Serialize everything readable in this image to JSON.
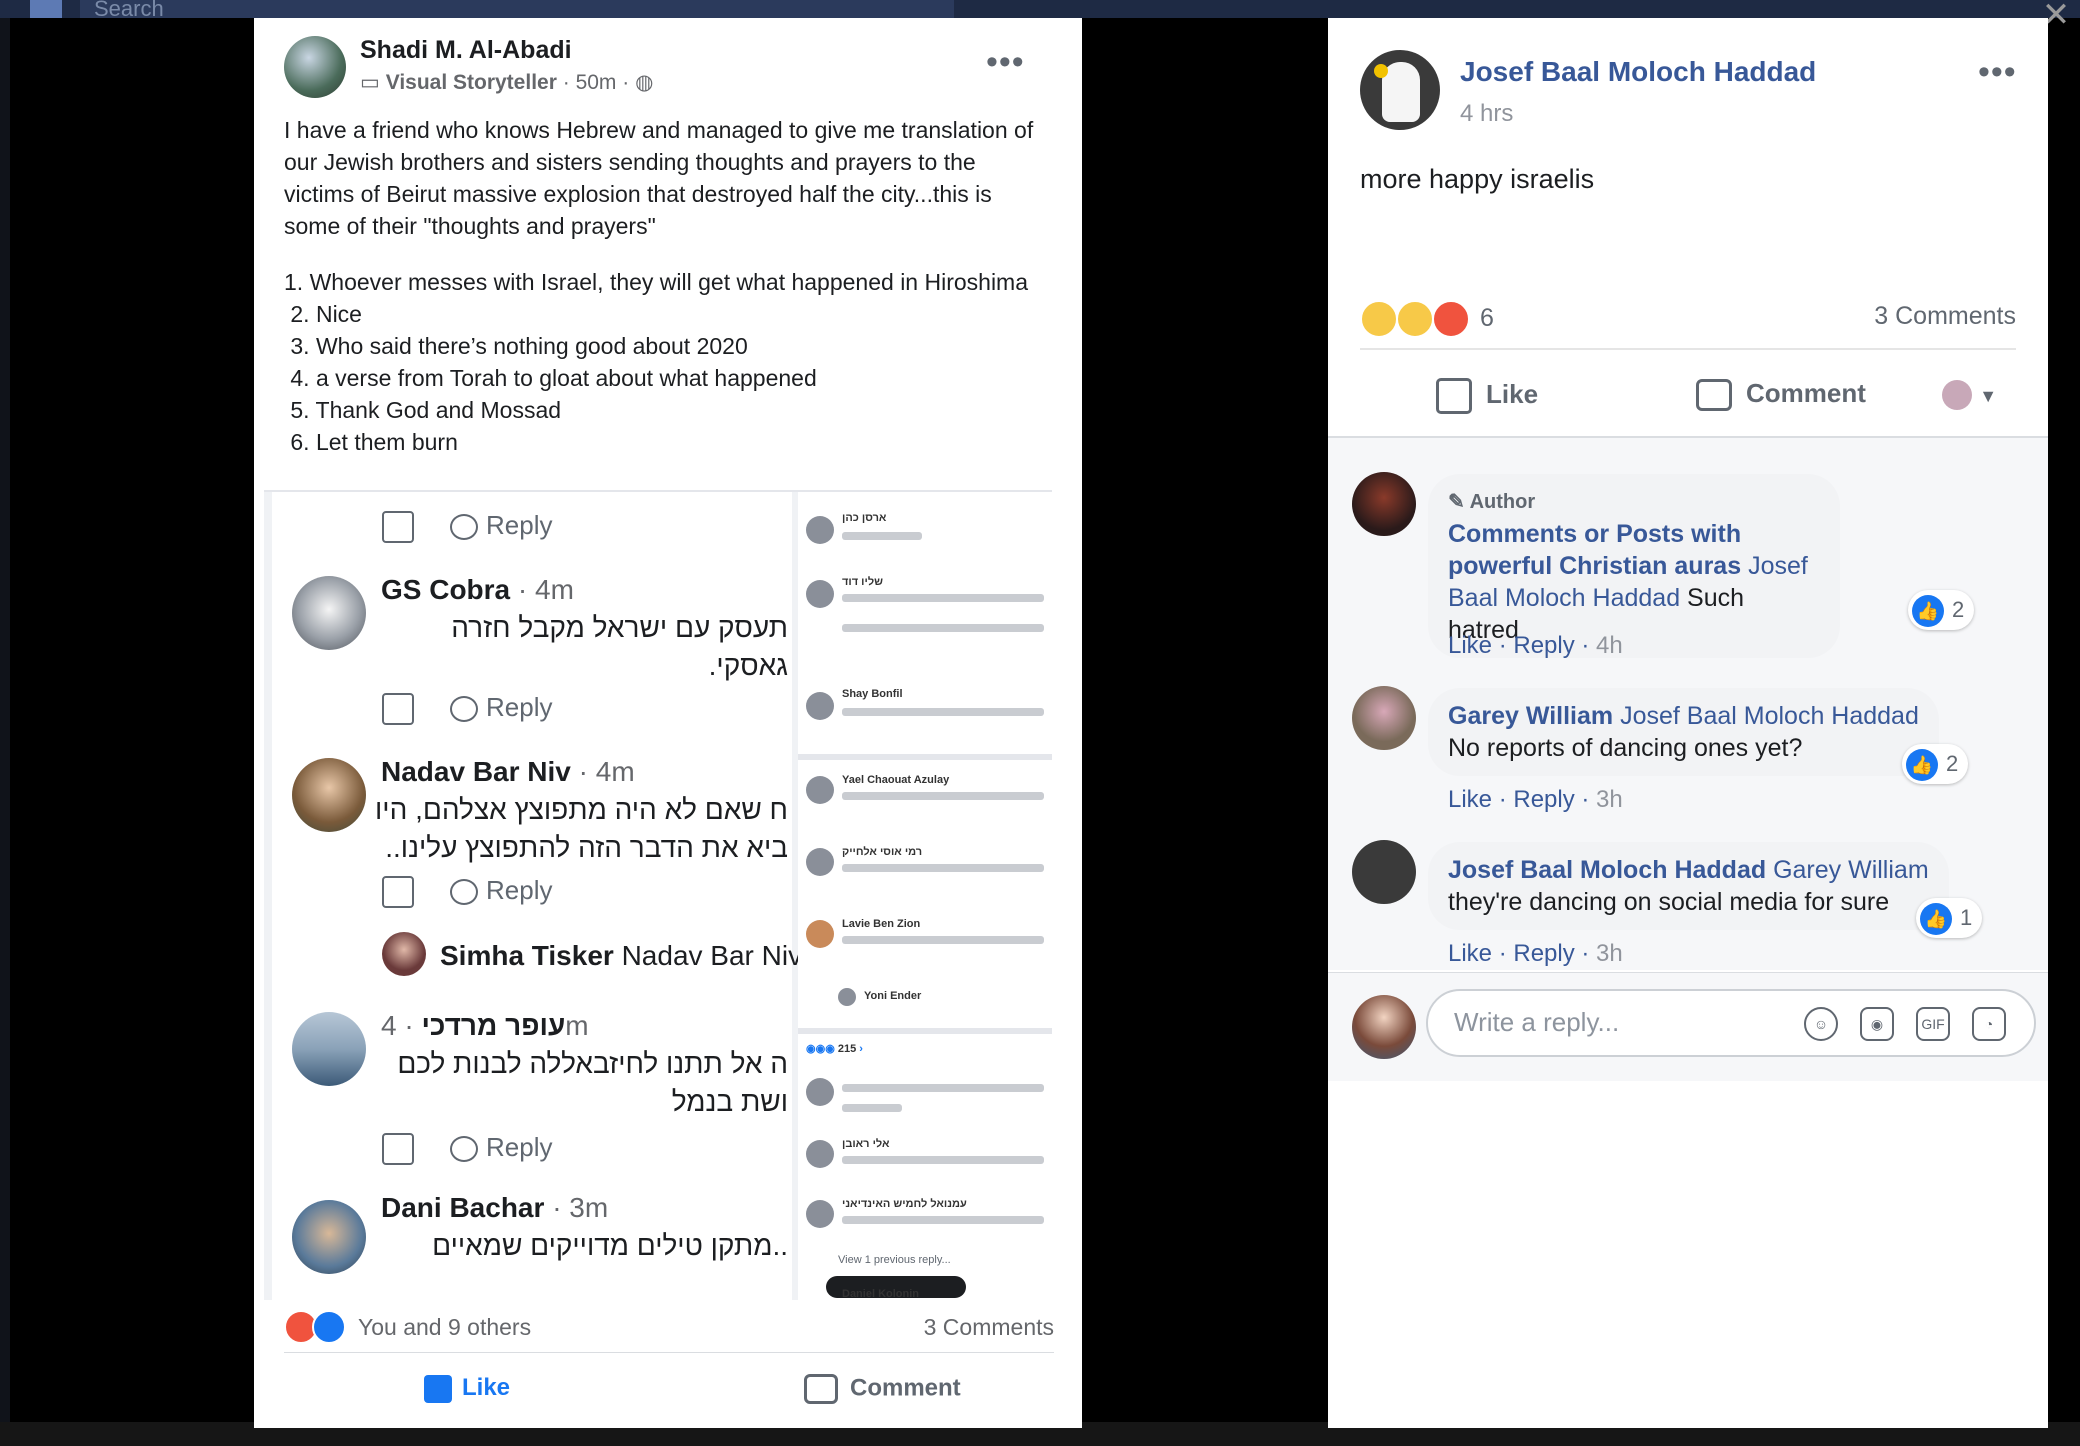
{
  "background": {
    "search_placeholder": "Search",
    "close_glyph": "✕"
  },
  "left_post": {
    "author": "Shadi M. Al-Abadi",
    "badge": "Visual Storyteller",
    "time": "50m",
    "more": "•••",
    "body": "I have a friend who knows Hebrew and managed to give me translation of our Jewish brothers and sisters sending thoughts and prayers to the victims of Beirut massive explosion that destroyed half the city...this is some of their \"thoughts and prayers\"",
    "list": [
      "1. Whoever messes with Israel, they will get what happened in Hiroshima",
      " 2. Nice",
      " 3. Who said there’s nothing good about 2020",
      " 4. a verse from Torah to gloat about what happened",
      " 5. Thank God and Mossad",
      " 6. Let them burn"
    ],
    "screenshot": {
      "reply_label": "Reply",
      "comments": [
        {
          "name": "GS Cobra",
          "time": "4m",
          "lines": [
            "תעסק עם ישראל מקבל חזרה",
            "גאסקי."
          ]
        },
        {
          "name": "Nadav Bar Niv",
          "time": "4m",
          "lines": [
            "ח שאם לא היה מתפוצץ אצלהם, היו",
            "ביא את הדבר הזה להתפוצץ עלינו.."
          ]
        },
        {
          "name": "עופר מרדכי",
          "time": "4m",
          "lines": [
            "ה אל תתנו לחיזבאללה לבנות לכם",
            "ושת בנמל"
          ]
        },
        {
          "name": "Dani Bachar",
          "time": "3m",
          "lines": [
            "..מתקן טילים מדוייקים שמאיים"
          ]
        }
      ],
      "nested_reply": {
        "name": "Simha Tisker",
        "mention": "Nadav Bar Niv ."
      },
      "mini_names": [
        "ארסן כהן",
        "שליו דוד",
        "Shay Bonfil",
        "Yael Chaouat Azulay",
        "רמי אוסי אלחייק",
        "Lavie Ben Zion",
        "Yoni Ender",
        "אלי ראובן",
        "עמנואל לחמיש האינדיאני",
        "Daniel Kolonin"
      ],
      "mini_count": "215",
      "mini_view_prev": "View 1 previous reply..."
    },
    "reactions_summary": "You and 9 others",
    "comments_count": "3 Comments",
    "like_label": "Like",
    "comment_label": "Comment"
  },
  "right_post": {
    "author": "Josef Baal Moloch Haddad",
    "time": "4 hrs",
    "more": "•••",
    "text": "more happy israelis",
    "reaction_count": "6",
    "comments_count": "3 Comments",
    "like_label": "Like",
    "comment_label": "Comment",
    "comments": [
      {
        "badge": "Author",
        "name": "Comments or Posts with powerful Christian auras",
        "mention": "Josef Baal Moloch Haddad",
        "text": "Such hatred",
        "like": "Like",
        "reply": "Reply",
        "time": "4h",
        "likes": "2"
      },
      {
        "name": "Garey William",
        "mention": "Josef Baal Moloch Haddad",
        "text": "No reports of dancing ones yet?",
        "like": "Like",
        "reply": "Reply",
        "time": "3h",
        "likes": "2"
      },
      {
        "name": "Josef Baal Moloch Haddad",
        "mention": "Garey William",
        "text": "they're dancing on social media for sure",
        "like": "Like",
        "reply": "Reply",
        "time": "3h",
        "likes": "1"
      }
    ],
    "reply_placeholder": "Write a reply...",
    "reply_icons": [
      "smiley-icon",
      "camera-icon",
      "gif-icon",
      "sticker-icon"
    ],
    "gif_label": "GIF"
  },
  "colors": {
    "link": "#385898",
    "fb_blue": "#1877f2",
    "angry": "#f0533e",
    "like": "#1877f2"
  }
}
